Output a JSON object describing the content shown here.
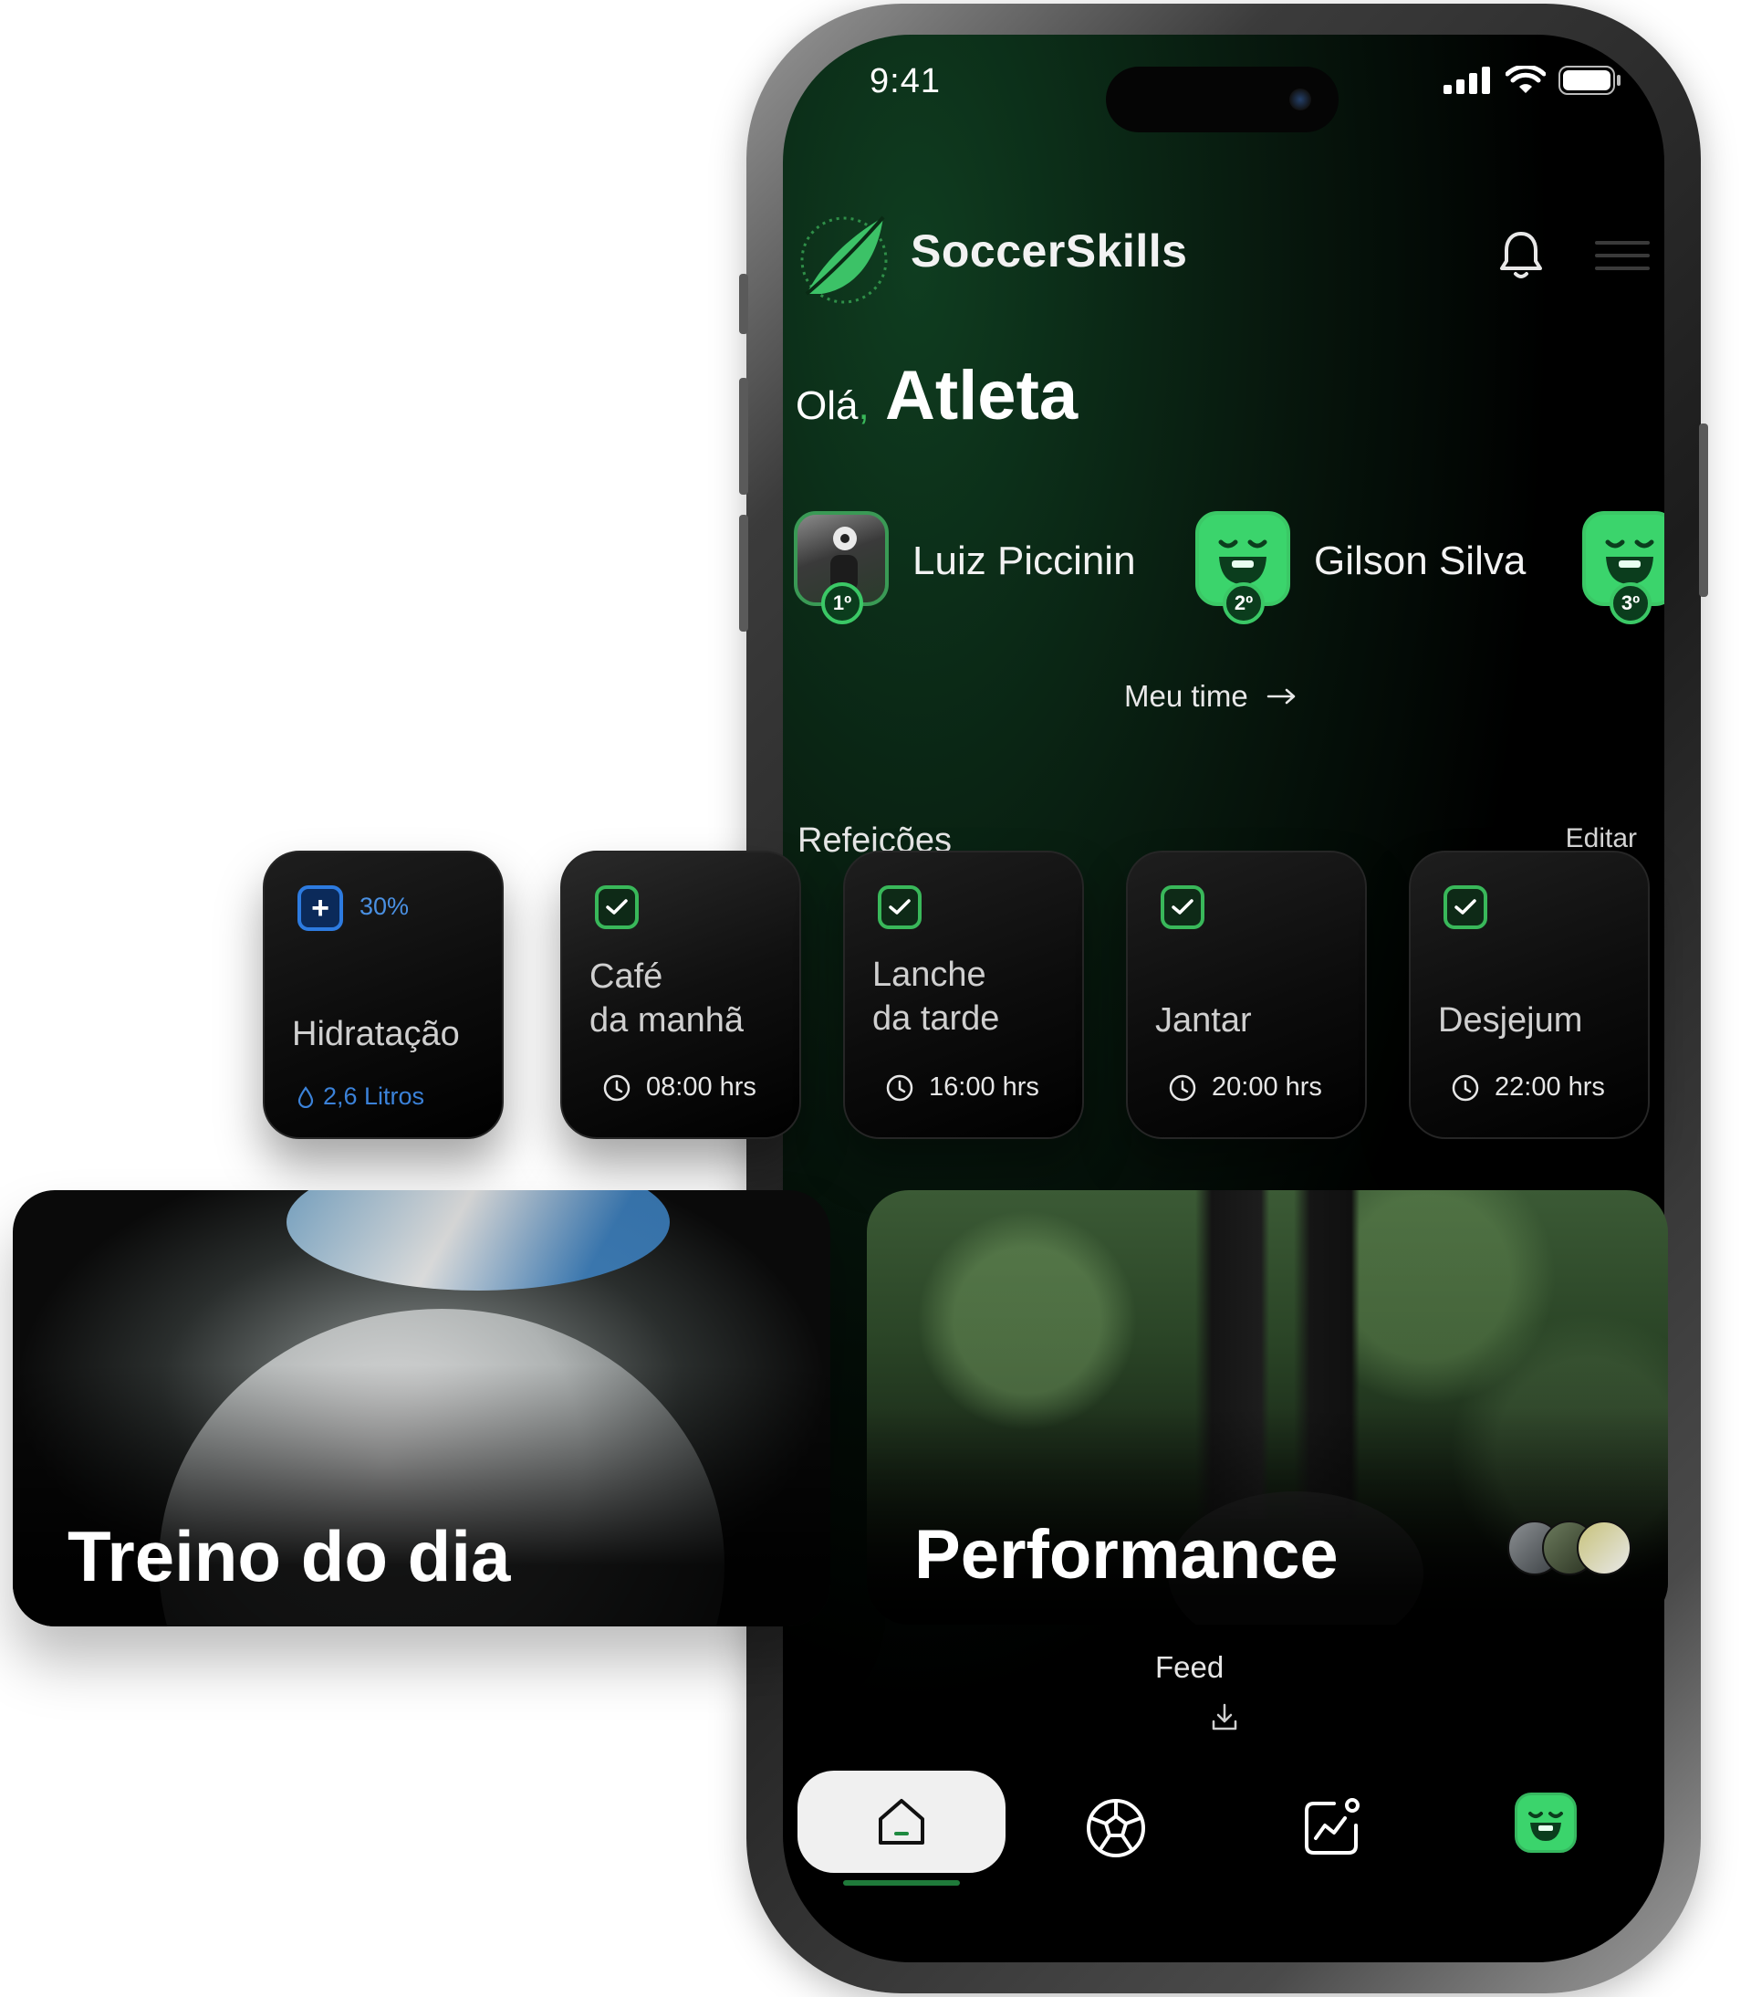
{
  "status": {
    "time": "9:41"
  },
  "header": {
    "brand": "SoccerSkills"
  },
  "greeting": {
    "hello": "Olá",
    "comma": ",",
    "name": "Atleta"
  },
  "ranking": [
    {
      "name": "Luiz Piccinin",
      "position": "1º",
      "avatar": "photo"
    },
    {
      "name": "Gilson Silva",
      "position": "2º",
      "avatar": "mascot"
    },
    {
      "name": "",
      "position": "3º",
      "avatar": "mascot"
    }
  ],
  "team_link": {
    "label": "Meu time"
  },
  "meals_section": {
    "title": "Refeições",
    "edit": "Editar"
  },
  "hydration": {
    "percent": "30%",
    "title": "Hidratação",
    "amount": "2,6 Litros"
  },
  "meals": [
    {
      "line1": "Café",
      "line2": "da manhã",
      "time": "08:00 hrs"
    },
    {
      "line1": "Lanche",
      "line2": "da tarde",
      "time": "16:00 hrs"
    },
    {
      "line1": "Jantar",
      "line2": "",
      "time": "20:00 hrs"
    },
    {
      "line1": "Desjejum",
      "line2": "",
      "time": "22:00 hrs"
    }
  ],
  "features": {
    "training": "Treino do dia",
    "performance": "Performance"
  },
  "feed": {
    "label": "Feed"
  },
  "colors": {
    "accent": "#39b85a",
    "mascot": "#3bd46c",
    "hydration": "#3b82d9",
    "background": "#000000"
  },
  "nav": {
    "items": [
      "home-icon",
      "ball-icon",
      "performance-icon",
      "profile-icon"
    ],
    "active": "home-icon"
  }
}
